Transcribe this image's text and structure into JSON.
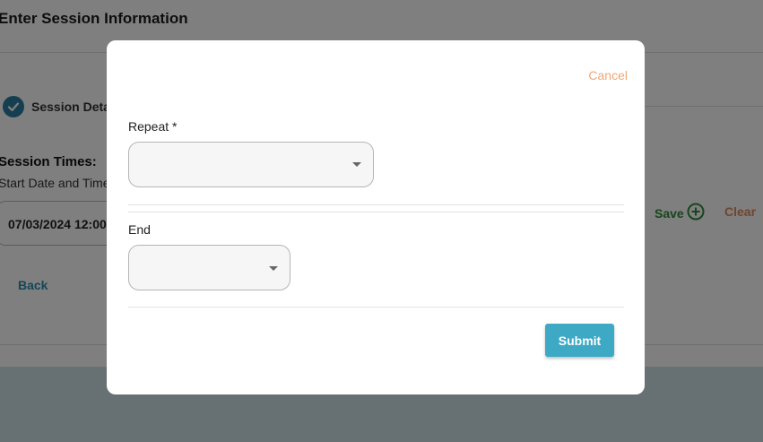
{
  "background": {
    "title": "Enter Session Information",
    "step_label": "Session Detai",
    "section_title": "Session Times:",
    "start_label": "Start Date and Time",
    "start_value": "07/03/2024 12:00",
    "back_label": "Back",
    "save_label": "Save",
    "clear_label": "Clear"
  },
  "modal": {
    "cancel_label": "Cancel",
    "repeat_label": "Repeat *",
    "repeat_value": "",
    "end_label": "End",
    "end_value": "",
    "submit_label": "Submit"
  },
  "colors": {
    "accent": "#3ea9c4",
    "cancel": "#f0a676",
    "save": "#2e8b3a",
    "clear": "#e08a5a",
    "step": "#2a7fa0"
  }
}
